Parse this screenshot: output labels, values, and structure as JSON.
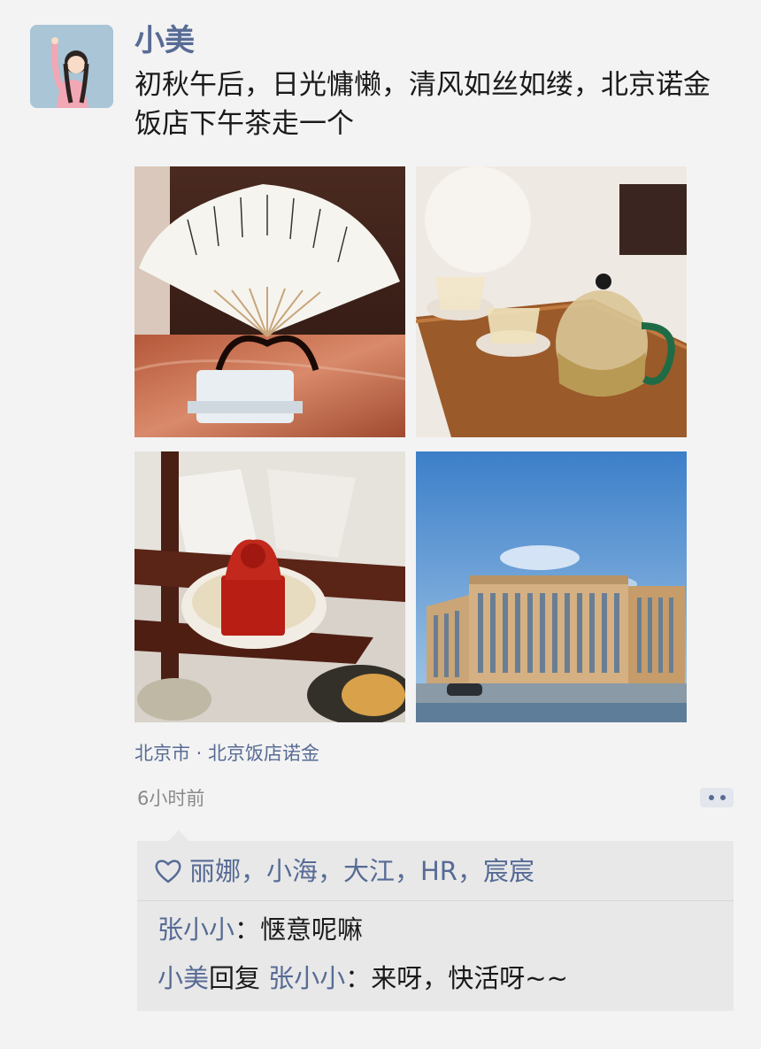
{
  "post": {
    "author": "小美",
    "text": "初秋午后，日光慵懒，清风如丝如缕，北京诺金饭店下午茶走一个",
    "photos": [
      {
        "subject": "folding-fan-photo"
      },
      {
        "subject": "tea-set-photo"
      },
      {
        "subject": "red-seal-pastry-photo"
      },
      {
        "subject": "hotel-building-photo"
      }
    ],
    "location": "北京市 · 北京饭店诺金",
    "time": "6小时前"
  },
  "likes": {
    "icon": "heart-icon",
    "names": "丽娜，小海，大江，HR，宸宸"
  },
  "comments": [
    {
      "author": "张小小",
      "separator": "：",
      "text": "惬意呢嘛"
    },
    {
      "author": "小美",
      "reply_word": "回复",
      "target": " 张小小",
      "separator": "：",
      "text": "来呀，快活呀~~"
    }
  ],
  "colors": {
    "link": "#576b95",
    "background": "#f3f3f3",
    "comment_box": "#e8e8e8"
  }
}
